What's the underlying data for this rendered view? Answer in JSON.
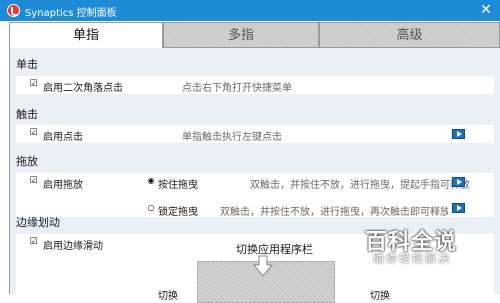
{
  "window": {
    "title": "Synaptics 控制面板",
    "close_glyph": "✕"
  },
  "tabs": [
    {
      "label": "单指",
      "active": true
    },
    {
      "label": "多指",
      "active": false
    },
    {
      "label": "高级",
      "active": false
    }
  ],
  "sections": {
    "single_click": {
      "title": "单击",
      "item": {
        "label": "启用二次角落点击",
        "checked": true,
        "description": "点击右下角打开快捷菜单"
      }
    },
    "tap": {
      "title": "触击",
      "item": {
        "label": "启用点击",
        "checked": true,
        "description": "单指触击执行左键点击"
      }
    },
    "drag": {
      "title": "拖放",
      "item": {
        "label": "启用拖放",
        "checked": true
      },
      "options": [
        {
          "label": "按住拖曳",
          "selected": true,
          "description": "双触击，并按住不放，进行拖曳，提起手指可释放"
        },
        {
          "label": "锁定拖曳",
          "selected": false,
          "description": "双触击，并按住不放，进行拖曳，再次触击即可释放"
        }
      ]
    },
    "edge_swipe": {
      "title": "边缘划动",
      "item": {
        "label": "启用边缘滑动",
        "checked": true
      },
      "top_label": "切换应用程序栏",
      "left_label": "切换",
      "right_label": "切换"
    }
  },
  "icons": {
    "checkbox_glyph": "☑",
    "radio_on_glyph": "◉",
    "radio_off_glyph": "○",
    "video": "video-play-icon",
    "app": "synaptics-logo-icon",
    "arrow": "down-arrow-icon"
  },
  "watermark": {
    "main": "百科全说",
    "sub": "助你轻松解决"
  },
  "colors": {
    "titlebar": "#1e8bd6",
    "panel": "#eaf0f6",
    "tab_inactive": "#c8c8c8",
    "link_icon": "#1f6fb9"
  }
}
